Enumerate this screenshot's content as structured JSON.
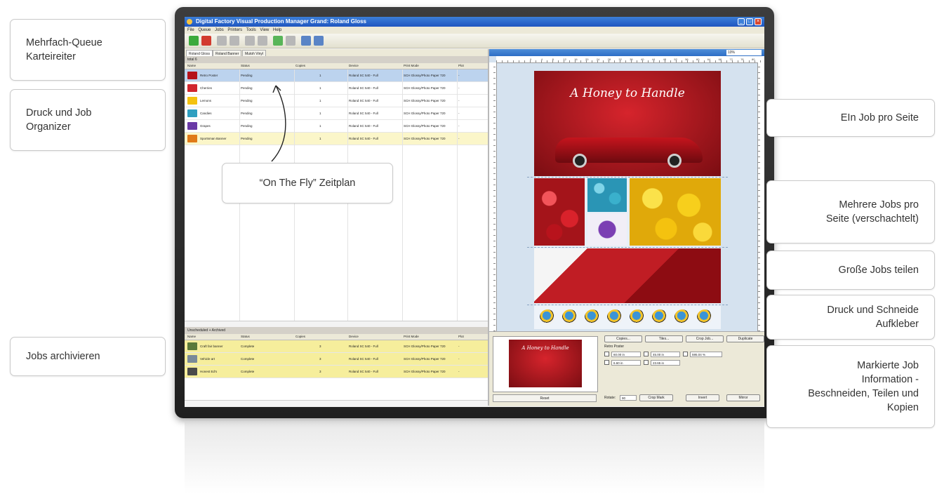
{
  "callouts": {
    "left": [
      "Mehrfach-Queue\nKarteireiter",
      "Druck und Job\nOrganizer",
      "Jobs archivieren"
    ],
    "center": "“On The Fly” Zeitplan",
    "right": [
      "EIn Job pro Seite",
      "Mehrere Jobs pro\nSeite (verschachtelt)",
      "Große Jobs teilen",
      "Druck und Schneide\nAufkleber",
      "Markierte Job\nInformation -\nBeschneiden, Teilen und\nKopien"
    ]
  },
  "app": {
    "title": "Digital Factory Visual Production Manager Grand: Roland Gloss",
    "menu": [
      "File",
      "Queue",
      "Jobs",
      "Printers",
      "Tools",
      "View",
      "Help"
    ]
  },
  "queue": {
    "tabs": [
      "Roland Gloss",
      "Roland Banner",
      "Mutoh Vinyl"
    ],
    "total": "total 6",
    "columns": [
      "Name",
      "Status",
      "Copies",
      "Device",
      "Print Mode",
      "Plot"
    ],
    "jobs": [
      {
        "name": "Retro Poster",
        "status": "Pending",
        "copies": "1",
        "device": "Roland SC 540 - Full",
        "mode": "SCH Glossy/Photo Paper 720",
        "plot": "-",
        "color": "#b5121b"
      },
      {
        "name": "Cherries",
        "status": "Pending",
        "copies": "1",
        "device": "Roland SC 540 - Full",
        "mode": "SCH Glossy/Photo Paper 720",
        "plot": "-",
        "color": "#d1262e"
      },
      {
        "name": "Lemons",
        "status": "Pending",
        "copies": "1",
        "device": "Roland SC 540 - Full",
        "mode": "SCH Glossy/Photo Paper 720",
        "plot": "-",
        "color": "#f4c20f"
      },
      {
        "name": "Candies",
        "status": "Pending",
        "copies": "1",
        "device": "Roland SC 540 - Full",
        "mode": "SCH Glossy/Photo Paper 720",
        "plot": "-",
        "color": "#2f9fc0"
      },
      {
        "name": "Grapes",
        "status": "Pending",
        "copies": "1",
        "device": "Roland SC 540 - Full",
        "mode": "SCH Glossy/Photo Paper 720",
        "plot": "-",
        "color": "#6a3aa6"
      },
      {
        "name": "Sportsman Banner",
        "status": "Pending",
        "copies": "1",
        "device": "Roland SC 540 - Full",
        "mode": "SCH Glossy/Photo Paper 720",
        "plot": "-",
        "color": "#e07a18"
      }
    ]
  },
  "archive": {
    "title": "Unscheduled + Archived",
    "columns": [
      "Name",
      "Status",
      "Copies",
      "Device",
      "Print Mode",
      "Plot"
    ],
    "jobs": [
      {
        "name": "Craft fair banner",
        "status": "Complete",
        "copies": "3",
        "device": "Roland SC 540 - Full",
        "mode": "SCH Glossy/Photo Paper 720",
        "plot": "-",
        "color": "#5b7a3a"
      },
      {
        "name": "Vehicle art",
        "status": "Complete",
        "copies": "3",
        "device": "Roland SC 540 - Full",
        "mode": "SCH Glossy/Photo Paper 720",
        "plot": "-",
        "color": "#7a8a99"
      },
      {
        "name": "Honest Ed's",
        "status": "Complete",
        "copies": "3",
        "device": "Roland SC 540 - Full",
        "mode": "SCH Glossy/Photo Paper 720",
        "plot": "-",
        "color": "#4a4a4a"
      }
    ]
  },
  "preview": {
    "zoom": "10%",
    "ruler_top": [
      "0",
      "4",
      "8",
      "12",
      "16",
      "20",
      "24",
      "28",
      "32",
      "36",
      "40",
      "44",
      "48",
      "52",
      "56",
      "60",
      "64",
      "68",
      "72",
      "76",
      "80"
    ],
    "poster_title": "A Honey to Handle"
  },
  "details": {
    "preview_title": "A Honey to Handle",
    "buttons": [
      "Copies...",
      "Tiles...",
      "Crop Job...",
      "Duplicate"
    ],
    "job_name": "Retro Poster",
    "fields": {
      "width": "60.00 in",
      "height": "45.00 in",
      "scale": "595.04 %",
      "x": "6.60 in",
      "y": "23.65 in"
    },
    "reset_label": "Reset",
    "rotate_label": "Rotate:",
    "rotate_value": "90",
    "bottom_buttons": [
      "Crop Mark",
      "Invert",
      "Mirror"
    ]
  }
}
